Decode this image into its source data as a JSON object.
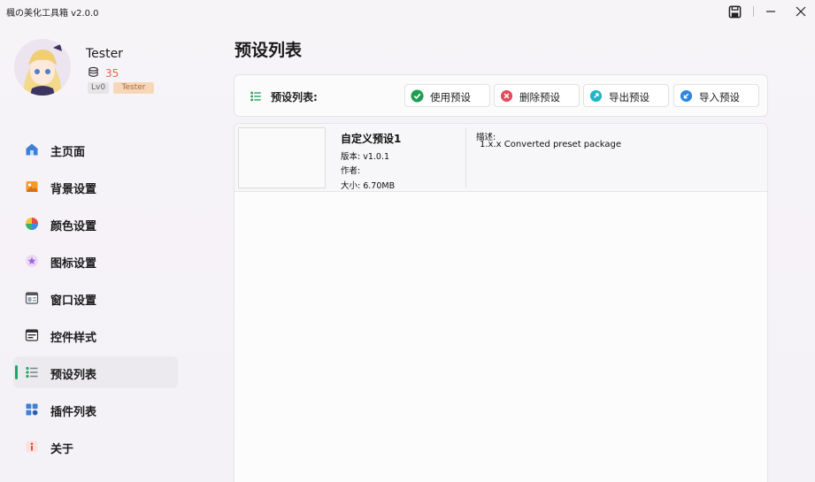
{
  "app": {
    "title": "楓の美化工具箱 v2.0.0"
  },
  "user": {
    "name": "Tester",
    "coins": "35",
    "level": "Lv0",
    "role": "Tester"
  },
  "sidebar": {
    "items": [
      {
        "label": "主页面",
        "icon": "home-icon"
      },
      {
        "label": "背景设置",
        "icon": "image-icon"
      },
      {
        "label": "颜色设置",
        "icon": "palette-icon"
      },
      {
        "label": "图标设置",
        "icon": "star-icon"
      },
      {
        "label": "窗口设置",
        "icon": "window-icon"
      },
      {
        "label": "控件样式",
        "icon": "control-icon"
      },
      {
        "label": "预设列表",
        "icon": "list-icon"
      },
      {
        "label": "插件列表",
        "icon": "plugin-icon"
      },
      {
        "label": "关于",
        "icon": "info-icon"
      }
    ],
    "active_index": 6
  },
  "main": {
    "page_title": "预设列表",
    "toolbar": {
      "label": "预设列表:",
      "buttons": [
        {
          "label": "使用预设",
          "icon": "check-icon"
        },
        {
          "label": "删除预设",
          "icon": "delete-icon"
        },
        {
          "label": "导出预设",
          "icon": "export-icon"
        },
        {
          "label": "导入预设",
          "icon": "import-icon"
        }
      ]
    },
    "presets": [
      {
        "name": "自定义预设1",
        "version": "版本: v1.0.1",
        "author": "作者:",
        "size": "大小: 6.70MB",
        "desc_label": "描述:",
        "desc": "1.x.x Converted preset package"
      }
    ]
  },
  "colors": {
    "accent": "#1aa76b",
    "coin": "#e06b4a"
  }
}
